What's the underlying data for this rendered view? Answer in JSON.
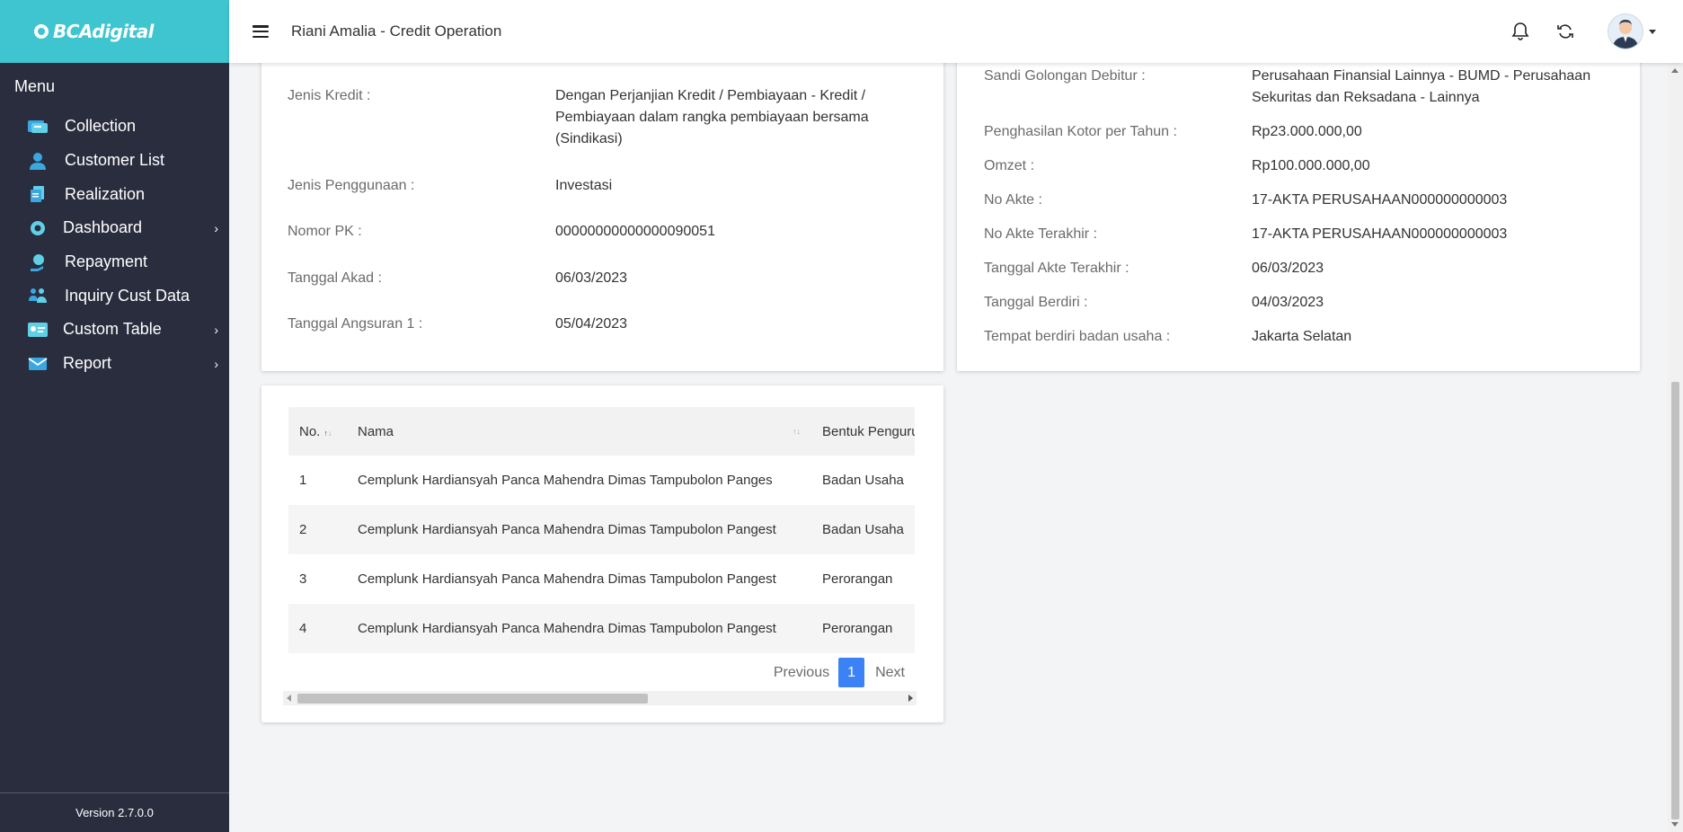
{
  "brand": {
    "name": "BCAdigital"
  },
  "sidebar": {
    "menu_title": "Menu",
    "items": [
      {
        "label": "Collection",
        "icon": "collection-icon",
        "has_sub": false
      },
      {
        "label": "Customer List",
        "icon": "user-icon",
        "has_sub": false
      },
      {
        "label": "Realization",
        "icon": "document-icon",
        "has_sub": false
      },
      {
        "label": "Dashboard",
        "icon": "dashboard-icon",
        "has_sub": true
      },
      {
        "label": "Repayment",
        "icon": "repayment-icon",
        "has_sub": false
      },
      {
        "label": "Inquiry Cust Data",
        "icon": "users-group-icon",
        "has_sub": false
      },
      {
        "label": "Custom Table",
        "icon": "id-card-icon",
        "has_sub": true
      },
      {
        "label": "Report",
        "icon": "mail-icon",
        "has_sub": true
      }
    ],
    "version": "Version 2.7.0.0"
  },
  "header": {
    "title": "Riani Amalia - Credit Operation",
    "icons": [
      "bell-icon",
      "refresh-icon",
      "avatar"
    ]
  },
  "left_card": {
    "fields": [
      {
        "label": "Jenis Kredit :",
        "value": "Dengan Perjanjian Kredit / Pembiayaan - Kredit / Pembiayaan dalam rangka pembiayaan bersama (Sindikasi)"
      },
      {
        "label": "Jenis Penggunaan :",
        "value": "Investasi"
      },
      {
        "label": "Nomor PK :",
        "value": "00000000000000090051"
      },
      {
        "label": "Tanggal Akad :",
        "value": "06/03/2023"
      },
      {
        "label": "Tanggal Angsuran 1 :",
        "value": "05/04/2023"
      }
    ]
  },
  "right_card": {
    "fields": [
      {
        "label": "Sandi Golongan Debitur :",
        "value": "Perusahaan Finansial Lainnya - BUMD - Perusahaan Sekuritas dan Reksadana - Lainnya"
      },
      {
        "label": "Penghasilan Kotor per Tahun :",
        "value": "Rp23.000.000,00"
      },
      {
        "label": "Omzet :",
        "value": "Rp100.000.000,00"
      },
      {
        "label": "No Akte :",
        "value": "17-AKTA PERUSAHAAN000000000003"
      },
      {
        "label": "No Akte Terakhir :",
        "value": "17-AKTA PERUSAHAAN000000000003"
      },
      {
        "label": "Tanggal Akte Terakhir :",
        "value": "06/03/2023"
      },
      {
        "label": "Tanggal Berdiri :",
        "value": "04/03/2023"
      },
      {
        "label": "Tempat berdiri badan usaha :",
        "value": "Jakarta Selatan"
      }
    ]
  },
  "table": {
    "columns": [
      "No.",
      "Nama",
      "Bentuk Pengurus"
    ],
    "rows": [
      [
        "1",
        "Cemplunk Hardiansyah Panca Mahendra Dimas Tampubolon Panges",
        "Badan Usaha"
      ],
      [
        "2",
        "Cemplunk Hardiansyah Panca Mahendra Dimas Tampubolon Pangest",
        "Badan Usaha"
      ],
      [
        "3",
        "Cemplunk Hardiansyah Panca Mahendra Dimas Tampubolon Pangest",
        "Perorangan"
      ],
      [
        "4",
        "Cemplunk Hardiansyah Panca Mahendra Dimas Tampubolon Pangest",
        "Perorangan"
      ]
    ],
    "pagination": {
      "previous": "Previous",
      "current": "1",
      "next": "Next"
    }
  },
  "colors": {
    "brand": "#3ec5cf",
    "sidebar": "#2a2d3e",
    "accent": "#3b82f6"
  }
}
